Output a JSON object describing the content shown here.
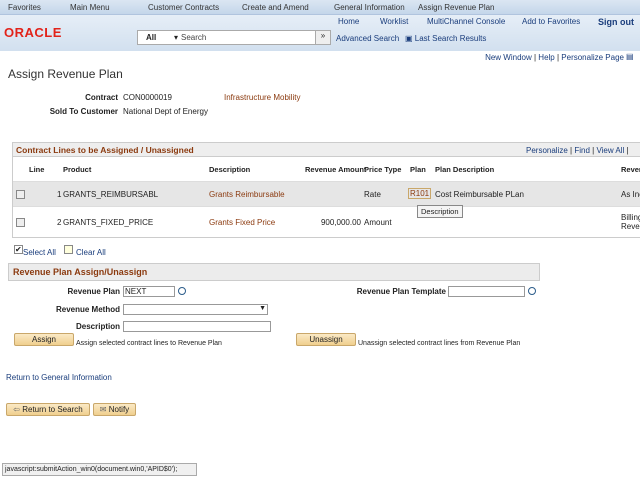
{
  "nav": {
    "favorites": "Favorites",
    "main_menu": "Main Menu",
    "customer_contracts": "Customer Contracts",
    "create_amend": "Create and Amend",
    "general_info": "General Information",
    "assign_plan": "Assign Revenue Plan"
  },
  "header": {
    "home": "Home",
    "worklist": "Worklist",
    "multichannel": "MultiChannel Console",
    "add_fav": "Add to Favorites",
    "sign_out": "Sign out",
    "logo": "ORACLE",
    "search_scope": "All",
    "search_placeholder": "Search",
    "advanced": "Advanced Search",
    "last_results": "Last Search Results"
  },
  "pagelinks": {
    "new_window": "New Window",
    "help": "Help",
    "personalize": "Personalize Page"
  },
  "page": {
    "title": "Assign Revenue Plan",
    "contract_label": "Contract",
    "contract_value": "CON0000019",
    "contract_desc": "Infrastructure Mobility",
    "sold_label": "Sold To Customer",
    "sold_value": "National Dept of Energy"
  },
  "grid": {
    "title": "Contract Lines to be Assigned / Unassigned",
    "personalize": "Personalize",
    "find": "Find",
    "view_all": "View All",
    "columns": [
      "Line",
      "Product",
      "Description",
      "Revenue Amount",
      "Price Type",
      "Plan",
      "Plan Description",
      "Reven"
    ],
    "rows": [
      {
        "line": "1",
        "product": "GRANTS_REIMBURSABL",
        "description": "Grants Reimbursable",
        "amount": "",
        "price_type": "Rate",
        "plan": "R101",
        "plan_desc": "Cost Reimbursable PLan",
        "revenue": "As Inc"
      },
      {
        "line": "2",
        "product": "GRANTS_FIXED_PRICE",
        "description": "Grants Fixed Price",
        "amount": "900,000.00",
        "price_type": "Amount",
        "plan": "",
        "plan_desc": "",
        "revenue": "Billing Reven"
      }
    ],
    "tooltip": "Description",
    "select_all": "Select All",
    "clear_all": "Clear All"
  },
  "assign": {
    "section": "Revenue Plan Assign/Unassign",
    "plan_label": "Revenue Plan",
    "plan_value": "NEXT",
    "template_label": "Revenue Plan Template",
    "method_label": "Revenue Method",
    "desc_label": "Description",
    "assign_btn": "Assign",
    "assign_hint": "Assign selected contract lines to Revenue Plan",
    "unassign_btn": "Unassign",
    "unassign_hint": "Unassign selected contract lines from Revenue Plan"
  },
  "footer": {
    "return_link": "Return to General Information",
    "return_search": "Return to Search",
    "notify": "Notify",
    "status": "javascript:submitAction_win0(document.win0,'APID$0');"
  }
}
